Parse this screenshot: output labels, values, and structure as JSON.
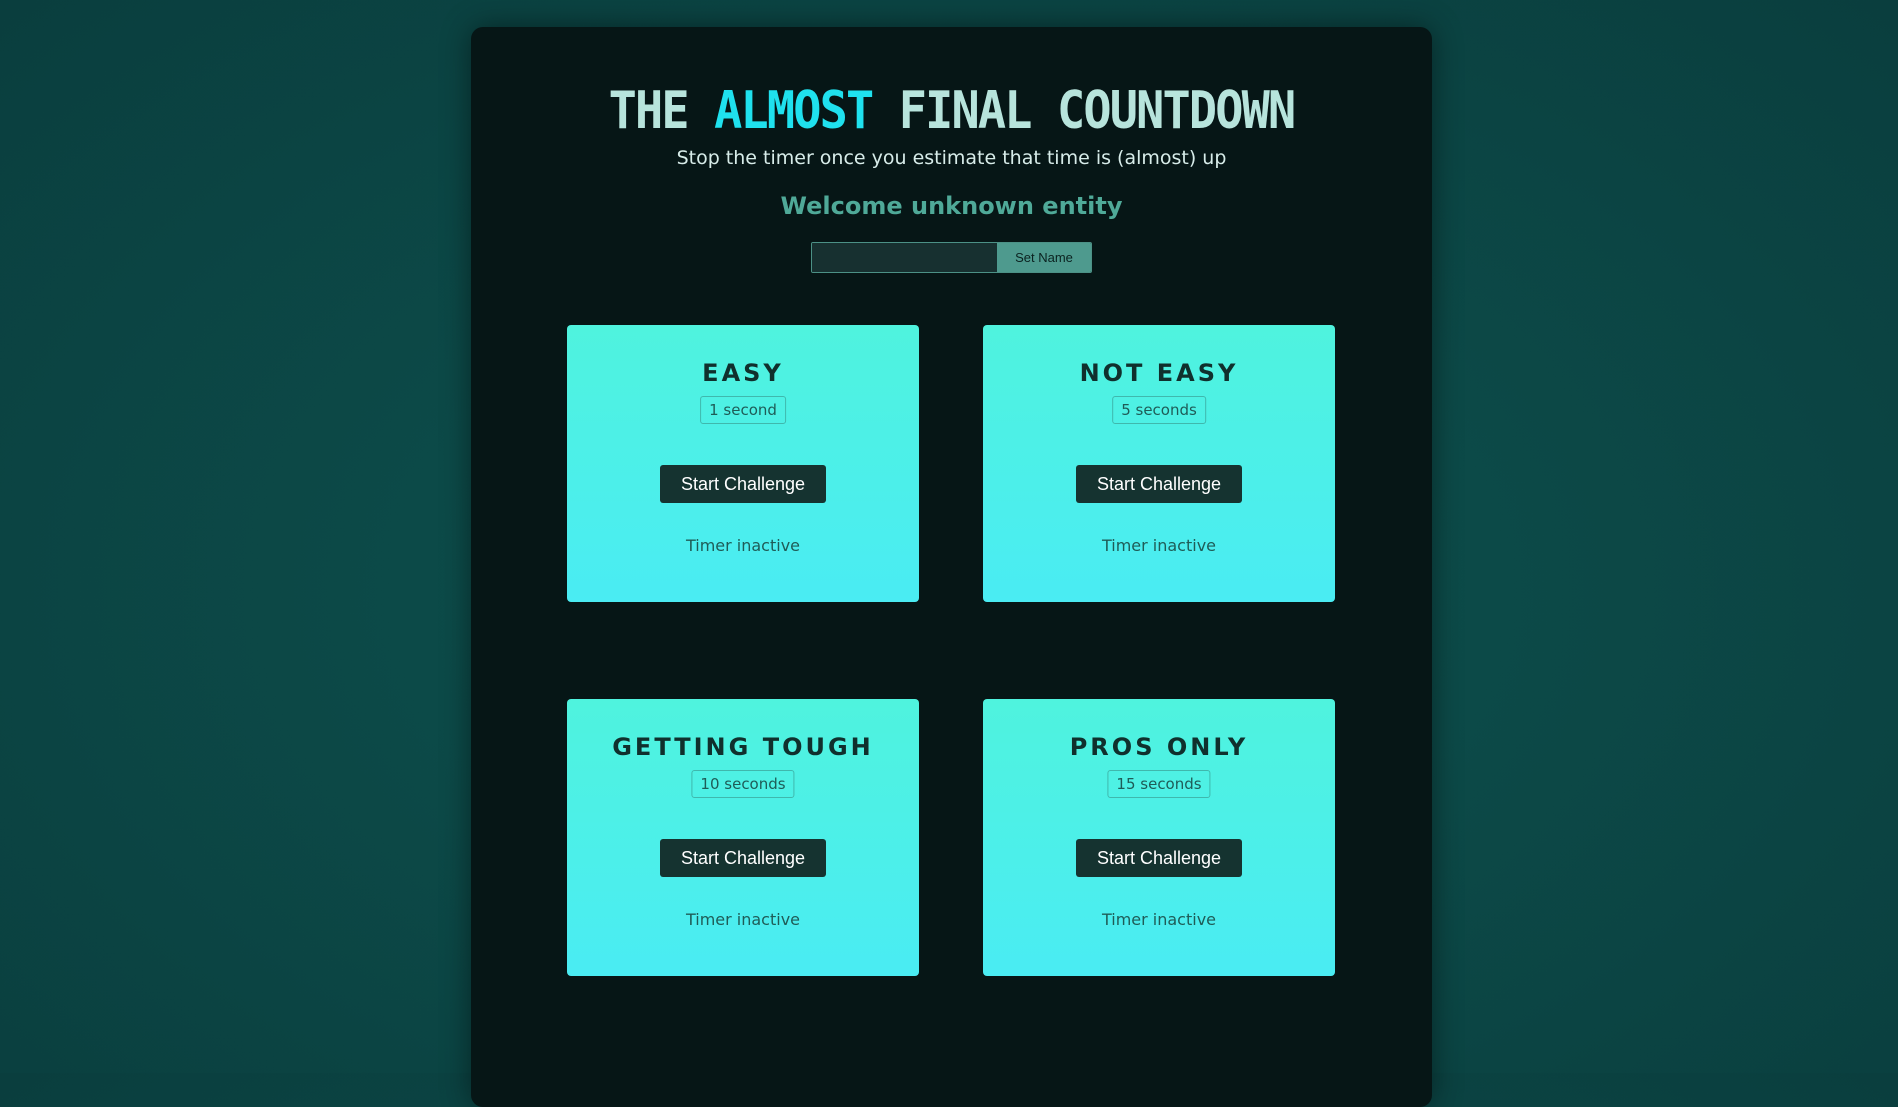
{
  "header": {
    "title_pre": "THE",
    "title_accent": "ALMOST",
    "title_post": "FINAL COUNTDOWN",
    "subtitle": "Stop the timer once you estimate that time is (almost) up",
    "welcome": "Welcome unknown entity"
  },
  "name_form": {
    "input_value": "",
    "input_placeholder": "",
    "button_label": "Set Name"
  },
  "challenges": [
    {
      "title": "EASY",
      "duration": "1 second",
      "button_label": "Start Challenge",
      "status": "Timer inactive"
    },
    {
      "title": "NOT EASY",
      "duration": "5 seconds",
      "button_label": "Start Challenge",
      "status": "Timer inactive"
    },
    {
      "title": "GETTING TOUGH",
      "duration": "10 seconds",
      "button_label": "Start Challenge",
      "status": "Timer inactive"
    },
    {
      "title": "PROS ONLY",
      "duration": "15 seconds",
      "button_label": "Start Challenge",
      "status": "Timer inactive"
    }
  ],
  "colors": {
    "background": "#0c4a48",
    "panel": "#061616",
    "title": "#b7e4dc",
    "title_accent": "#1fe1ee",
    "welcome": "#4fa998",
    "card_top": "#4ff3de",
    "card_bottom": "#4aecf3",
    "card_button": "#153330"
  }
}
